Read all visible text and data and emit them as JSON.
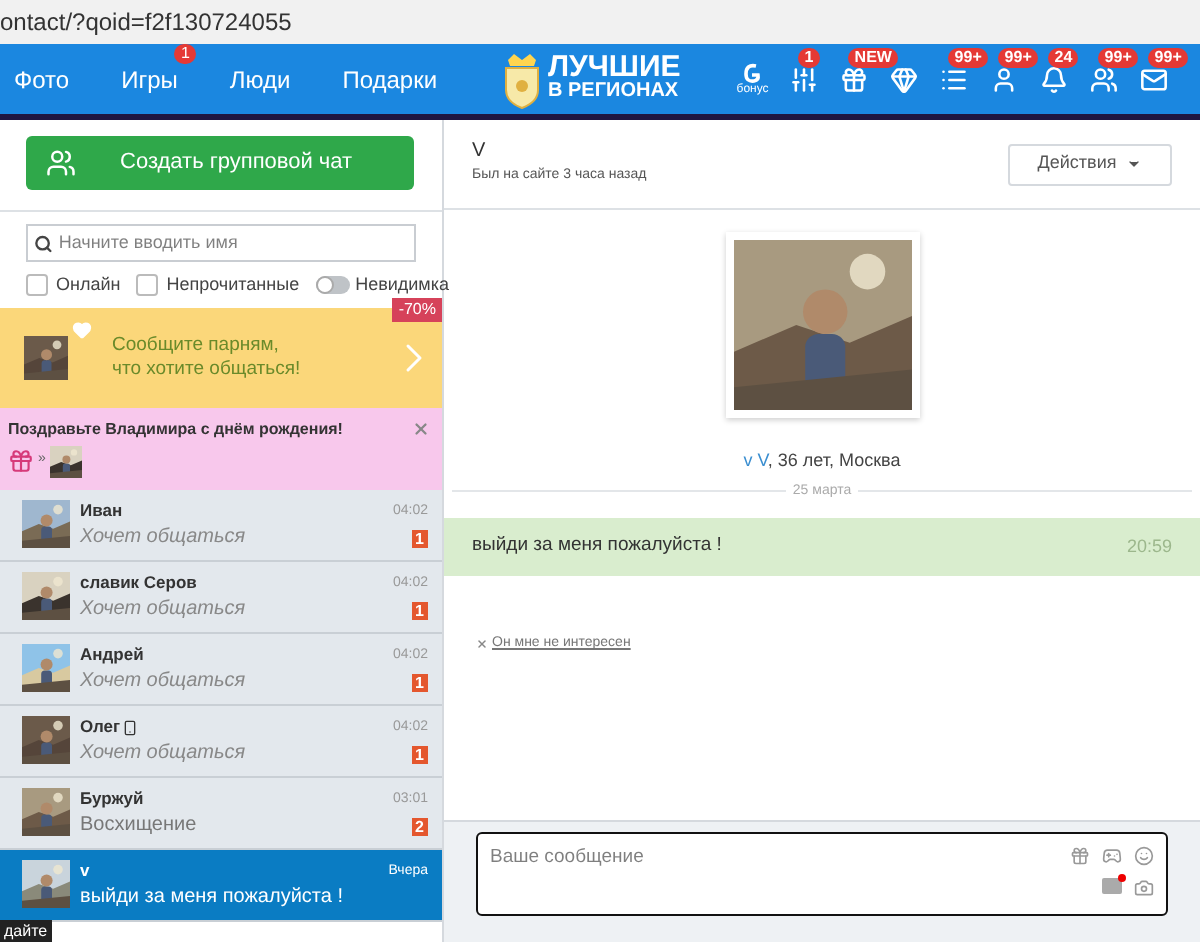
{
  "url": "ontact/?qoid=f2f130724055",
  "nav": {
    "links": [
      {
        "label": "Фото"
      },
      {
        "label": "Игры",
        "badge": "1"
      },
      {
        "label": "Люди"
      },
      {
        "label": "Подарки"
      }
    ],
    "logo": {
      "line1": "ЛУЧШИЕ",
      "line2": "В РЕГИОНАХ"
    },
    "icons": [
      {
        "kind": "bonus",
        "label": "бонус"
      },
      {
        "kind": "sliders",
        "badge": "1"
      },
      {
        "kind": "gift",
        "badge": "NEW"
      },
      {
        "kind": "gem"
      },
      {
        "kind": "list",
        "badge": "99+"
      },
      {
        "kind": "user",
        "badge": "99+"
      },
      {
        "kind": "bell",
        "badge": "24"
      },
      {
        "kind": "users",
        "badge": "99+"
      },
      {
        "kind": "mail",
        "badge": "99+"
      }
    ]
  },
  "sidebar": {
    "create_button": "Создать групповой чат",
    "search": {
      "placeholder": "Начните вводить имя"
    },
    "filters": [
      {
        "kind": "checkbox",
        "label": "Онлайн",
        "checked": false
      },
      {
        "kind": "checkbox",
        "label": "Непрочитанные",
        "checked": false
      },
      {
        "kind": "toggle",
        "label": "Невидимка",
        "on": false
      }
    ],
    "promo": {
      "discount": "-70%",
      "text": "Сообщите парням,\nчто хотите общаться!"
    },
    "birthday": {
      "text": "Поздравьте Владимира с днём рождения!",
      "arrow": "»"
    },
    "contacts": [
      {
        "name": "Иван",
        "phone": false,
        "preview": "Хочет общаться",
        "kind": "status",
        "time": "04:02",
        "unread": "1",
        "selected": false
      },
      {
        "name": "славик Серов",
        "phone": false,
        "preview": "Хочет общаться",
        "kind": "status",
        "time": "04:02",
        "unread": "1",
        "selected": false
      },
      {
        "name": "Андрей",
        "phone": false,
        "preview": "Хочет общаться",
        "kind": "status",
        "time": "04:02",
        "unread": "1",
        "selected": false
      },
      {
        "name": "Олег",
        "phone": true,
        "preview": "Хочет общаться",
        "kind": "status",
        "time": "04:02",
        "unread": "1",
        "selected": false
      },
      {
        "name": "Буржуй",
        "phone": false,
        "preview": "Восхищение",
        "kind": "message",
        "time": "03:01",
        "unread": "2",
        "selected": false
      },
      {
        "name": "v",
        "phone": false,
        "preview": "выйди за меня пожалуйста !",
        "kind": "message",
        "time": "Вчера",
        "selected": true
      }
    ],
    "tooltip": "дайте"
  },
  "chat": {
    "name": "V",
    "status": "Был на сайте 3 часа назад",
    "actions": "Действия",
    "profile": {
      "name": "v V",
      "details": ", 36 лет, Москва"
    },
    "date": "25 марта",
    "messages": [
      {
        "text": "выйди за меня пожалуйста !",
        "time": "20:59"
      }
    ],
    "not_interested": "Он мне не интересен",
    "composer": {
      "placeholder": "Ваше сообщение"
    }
  }
}
